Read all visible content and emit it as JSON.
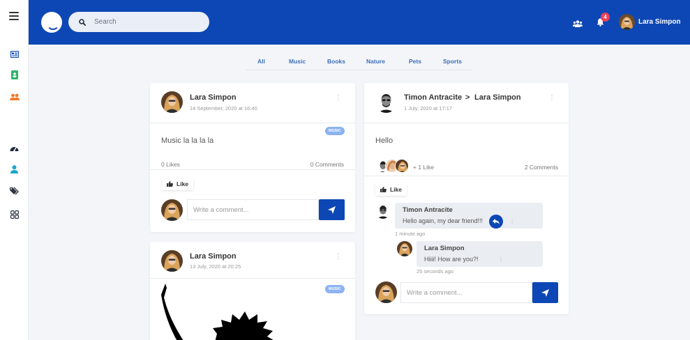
{
  "search": {
    "placeholder": "Search"
  },
  "header": {
    "notification_count": "4",
    "user_name": "Lara Simpon"
  },
  "sidebar": {
    "icons": [
      "menu-icon",
      "newspaper-icon",
      "contact-book-icon",
      "users-icon",
      "dashboard-icon",
      "user-icon",
      "tags-icon",
      "grid-icon"
    ]
  },
  "filters": [
    "All",
    "Music",
    "Books",
    "Nature",
    "Pets",
    "Sports"
  ],
  "posts": [
    {
      "author": "Lara Simpon",
      "date": "14 September, 2020 at 16:40",
      "tag": "MUSIC",
      "text": "Music la la la la",
      "likes": "0 Likes",
      "comments": "0 Comments",
      "like_label": "Like",
      "comment_placeholder": "Write a comment..."
    },
    {
      "author": "Lara Simpon",
      "date": "13 July, 2020 at 20:25",
      "tag": "MUSIC"
    }
  ],
  "post_right": {
    "author": "Timon Antracite",
    "arrow": ">",
    "recipient": "Lara Simpon",
    "date": "1 July, 2020 at 17:17",
    "text": "Hello",
    "likes_extra": "+ 1 Like",
    "comments": "2 Comments",
    "like_label": "Like",
    "comment_placeholder": "Write a comment...",
    "thread": [
      {
        "name": "Timon Antracite",
        "text": "Hello again, my dear friend!!!",
        "time": "1 minute ago"
      },
      {
        "name": "Lara Simpon",
        "text": "Hiiii! How are you?!",
        "time": "25 seconds ago"
      }
    ]
  },
  "colors": {
    "brand": "#0d47b5",
    "badge": "#f0405a",
    "tag": "#8cb3f2",
    "accent_green": "#2fb36a",
    "accent_orange": "#f07a2a",
    "accent_cyan": "#1ba6c9"
  }
}
